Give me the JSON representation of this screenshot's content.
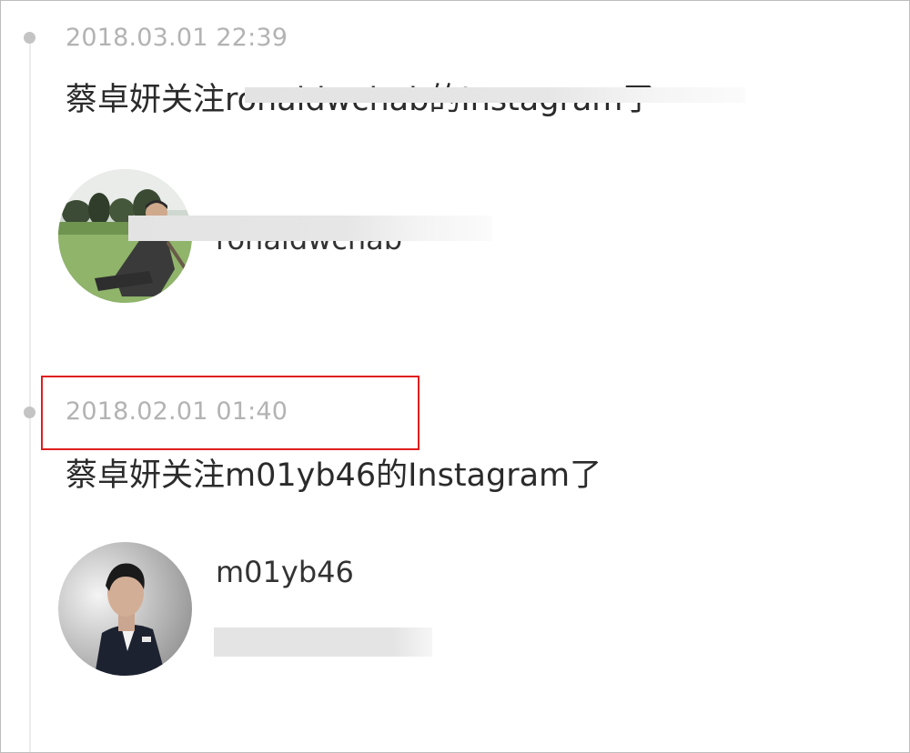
{
  "entries": [
    {
      "timestamp": "2018.03.01 22:39",
      "headline": "蔡卓妍关注ronaldwchab的Instagram了",
      "username": "ronaldwchab",
      "avatar_icon": "profile-photo-seated-man-garden",
      "redacted": true
    },
    {
      "timestamp": "2018.02.01 01:40",
      "headline": "蔡卓妍关注m01yb46的Instagram了",
      "username": "m01yb46",
      "avatar_icon": "profile-photo-man-in-suit",
      "redacted": false
    }
  ],
  "colors": {
    "timeline": "#ececec",
    "dot": "#c4c4c4",
    "timestamp": "#b3b3b3",
    "text": "#2b2b2b",
    "highlight": "#e01e1e"
  }
}
